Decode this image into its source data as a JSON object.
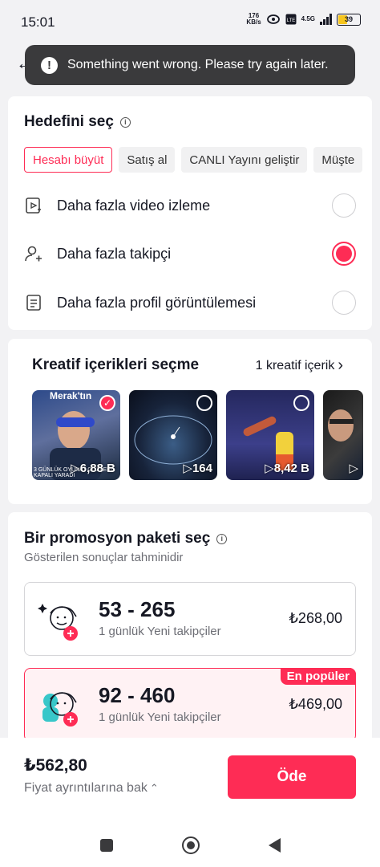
{
  "status_bar": {
    "time": "15:01",
    "network_speed": "176",
    "network_speed_unit": "KB/s",
    "network_type": "4.5G",
    "battery": "39"
  },
  "toast": {
    "message": "Something went wrong. Please try again later."
  },
  "goal_section": {
    "title": "Hedefini seç",
    "chips": [
      {
        "label": "Hesabı büyüt",
        "active": true
      },
      {
        "label": "Satış al",
        "active": false
      },
      {
        "label": "CANLI Yayını geliştir",
        "active": false
      },
      {
        "label": "Müşte",
        "active": false
      }
    ],
    "options": [
      {
        "label": "Daha fazla video izleme",
        "icon": "video-play-icon",
        "selected": false
      },
      {
        "label": "Daha fazla takipçi",
        "icon": "add-follower-icon",
        "selected": true
      },
      {
        "label": "Daha fazla profil görüntülemesi",
        "icon": "profile-document-icon",
        "selected": false
      }
    ]
  },
  "creative_section": {
    "title": "Kreatif içerikleri seçme",
    "link_label": "1 kreatif içerik",
    "thumbnails": [
      {
        "views": "6,88 B",
        "selected": true,
        "badge": "Merak'tın",
        "caption": "3 GÜNLÜK OYUNA / GÖZLERİ KAPALI YARADI"
      },
      {
        "views": "164",
        "selected": false
      },
      {
        "views": "8,42 B",
        "selected": false
      },
      {
        "views": "",
        "selected": false
      }
    ]
  },
  "promo_section": {
    "title": "Bir promosyon paketi seç",
    "subtitle": "Gösterilen sonuçlar tahminidir",
    "packages": [
      {
        "range": "53 - 265",
        "description": "1 günlük Yeni takipçiler",
        "price": "₺268,00",
        "badge": ""
      },
      {
        "range": "92 - 460",
        "description": "1 günlük Yeni takipçiler",
        "price": "₺469,00",
        "badge": "En popüler"
      }
    ]
  },
  "footer": {
    "total": "₺562,80",
    "details_label": "Fiyat ayrıntılarına bak",
    "order_button": "Öde"
  },
  "colors": {
    "accent": "#fe2c55",
    "toast_bg": "#3a3a3c"
  }
}
